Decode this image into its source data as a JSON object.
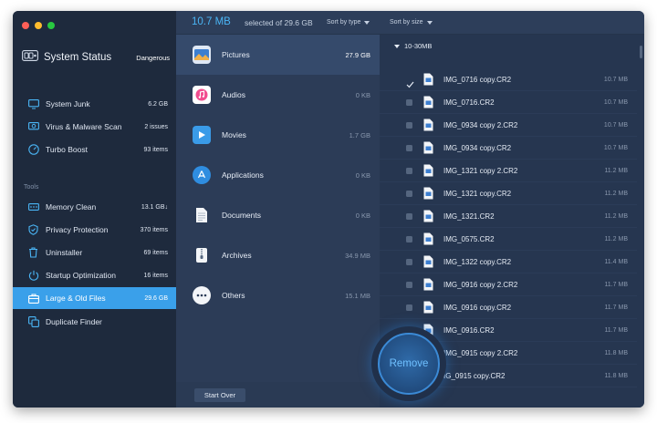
{
  "window": {
    "controls": [
      "close",
      "minimize",
      "zoom"
    ]
  },
  "sidebar": {
    "status": {
      "title": "System Status",
      "badge": "Dangerous",
      "icon": "system-status-icon"
    },
    "top_items": [
      {
        "label": "System Junk",
        "value": "6.2 GB",
        "icon": "monitor-icon"
      },
      {
        "label": "Virus & Malware Scan",
        "value": "2 issues",
        "icon": "scan-icon"
      },
      {
        "label": "Turbo Boost",
        "value": "93 items",
        "icon": "turbo-icon"
      }
    ],
    "tools_heading": "Tools",
    "tools": [
      {
        "label": "Memory Clean",
        "value": "13.1 GB↓",
        "icon": "memory-icon"
      },
      {
        "label": "Privacy Protection",
        "value": "370 items",
        "icon": "shield-icon"
      },
      {
        "label": "Uninstaller",
        "value": "69 items",
        "icon": "trash-icon"
      },
      {
        "label": "Startup Optimization",
        "value": "16 items",
        "icon": "power-icon"
      },
      {
        "label": "Large & Old Files",
        "value": "29.6 GB",
        "icon": "briefcase-icon",
        "active": true
      },
      {
        "label": "Duplicate Finder",
        "value": "",
        "icon": "duplicate-icon"
      }
    ]
  },
  "header": {
    "selected_size": "10.7 MB",
    "selected_of": "selected of 29.6 GB",
    "sort_type": "Sort by type",
    "sort_size": "Sort by size"
  },
  "categories": [
    {
      "label": "Pictures",
      "size": "27.9 GB",
      "icon": "pictures-icon",
      "selected": true
    },
    {
      "label": "Audios",
      "size": "0 KB",
      "icon": "music-icon"
    },
    {
      "label": "Movies",
      "size": "1.7 GB",
      "icon": "movie-icon"
    },
    {
      "label": "Applications",
      "size": "0 KB",
      "icon": "app-store-icon"
    },
    {
      "label": "Documents",
      "size": "0 KB",
      "icon": "document-icon"
    },
    {
      "label": "Archives",
      "size": "34.9 MB",
      "icon": "archive-icon"
    },
    {
      "label": "Others",
      "size": "15.1 MB",
      "icon": "more-icon"
    }
  ],
  "footer": {
    "start_over": "Start Over"
  },
  "files": {
    "group": "10-30MB",
    "rows": [
      {
        "name": "IMG_0716 copy.CR2",
        "size": "10.7 MB",
        "checked": true
      },
      {
        "name": "IMG_0716.CR2",
        "size": "10.7 MB",
        "checked": false
      },
      {
        "name": "IMG_0934 copy 2.CR2",
        "size": "10.7 MB",
        "checked": false
      },
      {
        "name": "IMG_0934 copy.CR2",
        "size": "10.7 MB",
        "checked": false
      },
      {
        "name": "IMG_1321 copy 2.CR2",
        "size": "11.2 MB",
        "checked": false
      },
      {
        "name": "IMG_1321 copy.CR2",
        "size": "11.2 MB",
        "checked": false
      },
      {
        "name": "IMG_1321.CR2",
        "size": "11.2 MB",
        "checked": false
      },
      {
        "name": "IMG_0575.CR2",
        "size": "11.2 MB",
        "checked": false
      },
      {
        "name": "IMG_1322 copy.CR2",
        "size": "11.4 MB",
        "checked": false
      },
      {
        "name": "IMG_0916 copy 2.CR2",
        "size": "11.7 MB",
        "checked": false
      },
      {
        "name": "IMG_0916 copy.CR2",
        "size": "11.7 MB",
        "checked": false
      },
      {
        "name": "IMG_0916.CR2",
        "size": "11.7 MB",
        "checked": false
      },
      {
        "name": "IMG_0915 copy 2.CR2",
        "size": "11.8 MB",
        "checked": false
      },
      {
        "name": "IG_0915 copy.CR2",
        "size": "11.8 MB",
        "checked": false
      }
    ]
  },
  "remove_button": "Remove",
  "colors": {
    "accent": "#3aa0ea",
    "sidebar_bg": "#1e2a3d",
    "panel_bg": "#2c3c57",
    "list_bg": "#263650"
  }
}
